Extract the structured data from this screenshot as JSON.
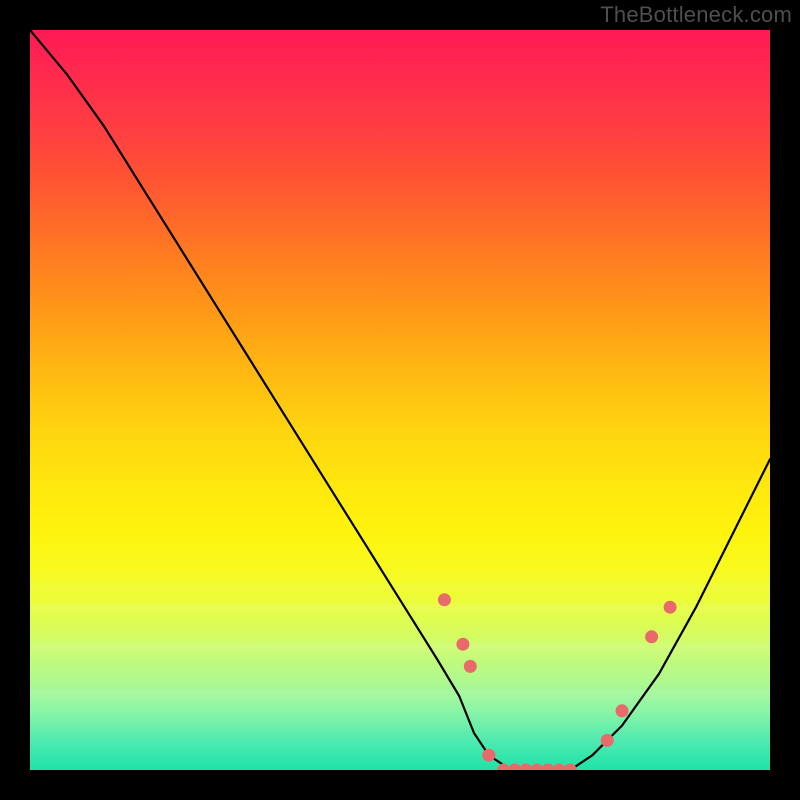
{
  "watermark": "TheBottleneck.com",
  "colors": {
    "background": "#000000",
    "curve": "#000000",
    "dots": "#e86a6a",
    "gradient_top": "#ff1a55",
    "gradient_bottom": "#1fe3a8"
  },
  "chart_data": {
    "type": "line",
    "title": "",
    "xlabel": "",
    "ylabel": "",
    "xlim": [
      0,
      100
    ],
    "ylim": [
      0,
      100
    ],
    "note": "V-shaped bottleneck curve. x unlabeled (interpreted 0-100), y is bottleneck % (0 at bottom = perfect match, 100 at top = full bottleneck). Values estimated from pixel positions.",
    "series": [
      {
        "name": "bottleneck-curve",
        "x": [
          0,
          5,
          10,
          15,
          20,
          25,
          30,
          35,
          40,
          45,
          50,
          55,
          58,
          60,
          62,
          65,
          70,
          73,
          76,
          80,
          85,
          90,
          95,
          100
        ],
        "y": [
          100,
          94,
          87,
          79,
          71,
          63,
          55,
          47,
          39,
          31,
          23,
          15,
          10,
          5,
          2,
          0,
          0,
          0,
          2,
          6,
          13,
          22,
          32,
          42
        ]
      }
    ],
    "markers": {
      "name": "highlighted-points",
      "comment": "Salmon dots clustered where curve nears/at zero and on the rising limbs around it.",
      "x": [
        56,
        58.5,
        59.5,
        62,
        64,
        65.5,
        67,
        68.5,
        70,
        71.5,
        73,
        78,
        80,
        84,
        86.5
      ],
      "y": [
        23,
        17,
        14,
        2,
        0,
        0,
        0,
        0,
        0,
        0,
        0,
        4,
        8,
        18,
        22
      ]
    }
  }
}
